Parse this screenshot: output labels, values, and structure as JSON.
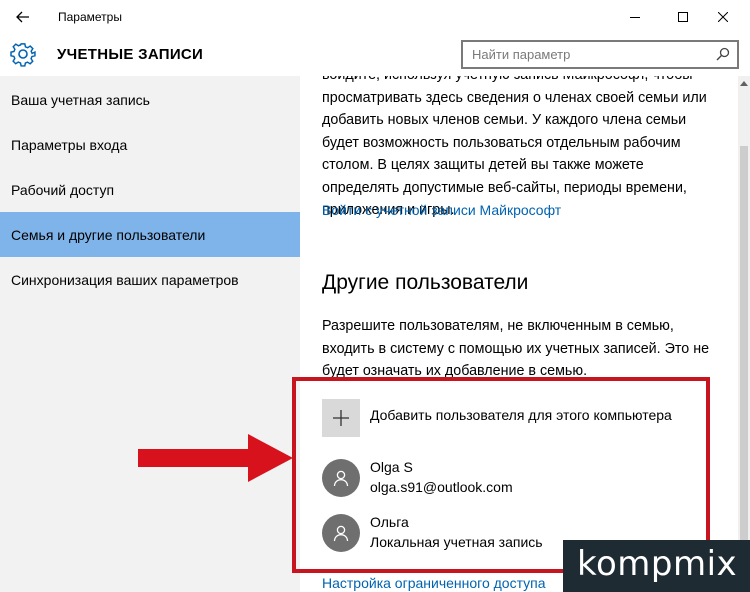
{
  "window": {
    "title": "Параметры",
    "minimize_glyph": "—",
    "maximize_glyph": "☐",
    "close_glyph": "✕"
  },
  "header": {
    "title": "УЧЕТНЫЕ ЗАПИСИ",
    "search_placeholder": "Найти параметр"
  },
  "sidebar": {
    "items": [
      {
        "label": "Ваша учетная запись",
        "active": false
      },
      {
        "label": "Параметры входа",
        "active": false
      },
      {
        "label": "Рабочий доступ",
        "active": false
      },
      {
        "label": "Семья и другие пользователи",
        "active": true
      },
      {
        "label": "Синхронизация ваших параметров",
        "active": false
      }
    ]
  },
  "main": {
    "family_text": "войдите, используя учетную запись Майкрософт, чтобы просматривать здесь сведения о членах своей семьи или добавить новых членов семьи. У каждого члена семьи будет возможность пользоваться отдельным рабочим столом. В целях защиты детей вы также можете определять допустимые веб-сайты, периоды времени, приложения и игры.",
    "family_link": "Войти с учетной записи Майкрософт",
    "others_heading": "Другие пользователи",
    "others_text": "Разрешите пользователям, не включенным в семью, входить в систему с помощью их учетных записей. Это не будет означать их добавление в семью.",
    "add_user_label": "Добавить пользователя для этого компьютера",
    "users": [
      {
        "name": "Olga S",
        "detail": "olga.s91@outlook.com"
      },
      {
        "name": "Ольга",
        "detail": "Локальная учетная запись"
      }
    ],
    "kiosk_link": "Настройка ограниченного доступа"
  },
  "watermark": {
    "text": "kompmix"
  },
  "colors": {
    "accent": "#7fb4ea",
    "link": "#0063b1",
    "highlight": "#c8141e",
    "sidebar_bg": "#f2f2f2",
    "avatar_bg": "#6f6f6f"
  }
}
